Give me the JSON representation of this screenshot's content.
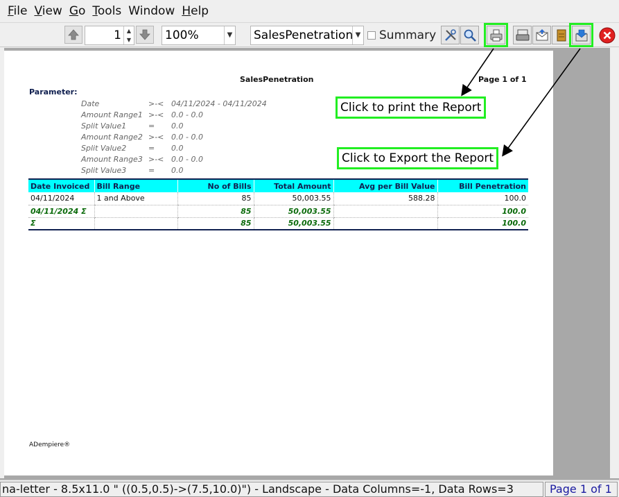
{
  "menu": [
    {
      "key": "F",
      "rest": "ile"
    },
    {
      "key": "V",
      "rest": "iew"
    },
    {
      "key": "G",
      "rest": "o"
    },
    {
      "key": "T",
      "rest": "ools"
    },
    {
      "key": "",
      "rest": "Window"
    },
    {
      "key": "H",
      "rest": "elp"
    }
  ],
  "toolbar": {
    "page_number": "1",
    "zoom": "100%",
    "report_view": "SalesPenetration",
    "summary_label": "Summary"
  },
  "report": {
    "title": "SalesPenetration",
    "page_label": "Page 1 of 1",
    "parameter_heading": "Parameter:",
    "parameters": [
      {
        "name": "Date",
        "op": ">-<",
        "value": "04/11/2024 - 04/11/2024"
      },
      {
        "name": "Amount Range1",
        "op": ">-<",
        "value": "0.0 - 0.0"
      },
      {
        "name": "Split Value1",
        "op": "=",
        "value": "0.0"
      },
      {
        "name": "Amount Range2",
        "op": ">-<",
        "value": "0.0 - 0.0"
      },
      {
        "name": "Split Value2",
        "op": "=",
        "value": "0.0"
      },
      {
        "name": "Amount Range3",
        "op": ">-<",
        "value": "0.0 - 0.0"
      },
      {
        "name": "Split Value3",
        "op": "=",
        "value": "0.0"
      }
    ],
    "columns": [
      "Date Invoiced",
      "Bill Range",
      "No of Bills",
      "Total Amount",
      "Avg per Bill Value",
      "Bill Penetration"
    ],
    "rows": [
      [
        "04/11/2024",
        "1 and Above",
        "85",
        "50,003.55",
        "588.28",
        "100.0"
      ],
      [
        "04/11/2024 Σ",
        "",
        "85",
        "50,003.55",
        "",
        "100.0"
      ],
      [
        "Σ",
        "",
        "85",
        "50,003.55",
        "",
        "100.0"
      ]
    ],
    "footer": "ADempiere®"
  },
  "callouts": {
    "print": "Click to print the Report",
    "export": "Click to Export the Report"
  },
  "status": {
    "info": "na-letter - 8.5x11.0 \" ((0.5,0.5)->(7.5,10.0)\") - Landscape - Data Columns=-1, Data Rows=3",
    "page": "Page 1 of 1"
  },
  "colors": {
    "highlight": "#22ee22",
    "table_header": "#00ffff",
    "summary_text": "#0a6a0a"
  },
  "icons": [
    "arrow-up-icon",
    "arrow-down-icon",
    "tools-icon",
    "zoom-icon",
    "print-icon",
    "print-preview-icon",
    "send-mail-icon",
    "archive-icon",
    "export-icon",
    "close-icon"
  ]
}
